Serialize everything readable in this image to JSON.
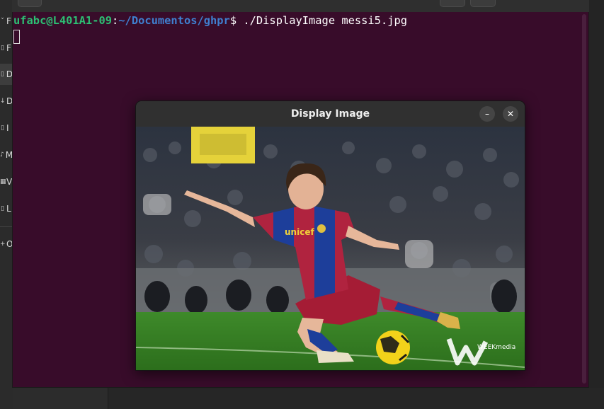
{
  "terminal": {
    "prompt_user": "ufabc@L401A1-09",
    "prompt_sep": ":",
    "prompt_path": "~/Documentos/ghpr",
    "prompt_symbol": "$ ",
    "command": "./DisplayImage messi5.jpg"
  },
  "sidebar": {
    "items": [
      {
        "icon": "chevron-down-icon",
        "letter": "F"
      },
      {
        "icon": "folder-icon",
        "letter": "F"
      },
      {
        "icon": "document-icon",
        "letter": "D"
      },
      {
        "icon": "download-icon",
        "letter": "D"
      },
      {
        "icon": "image-icon",
        "letter": "I"
      },
      {
        "icon": "music-icon",
        "letter": "M"
      },
      {
        "icon": "video-icon",
        "letter": "V"
      },
      {
        "icon": "trash-icon",
        "letter": "L"
      },
      {
        "icon": "plus-icon",
        "letter": "O"
      }
    ]
  },
  "dialog": {
    "title": "Display Image",
    "minimize": "–",
    "close": "✕"
  },
  "image": {
    "jersey_text": "unicef",
    "watermark": "WEEKmedia"
  },
  "colors": {
    "terminal_bg": "#380c2a",
    "prompt_user": "#2dbf73",
    "prompt_path": "#3f7fcf"
  }
}
